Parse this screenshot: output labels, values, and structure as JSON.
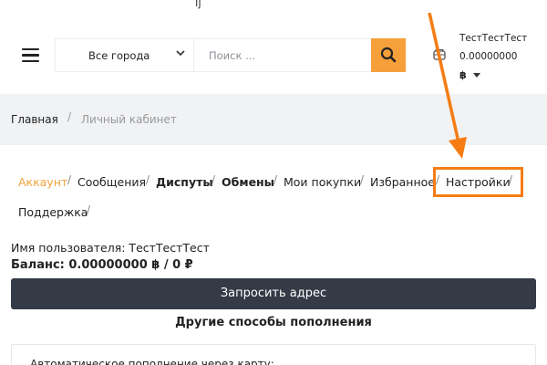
{
  "header": {
    "top_glyph": "ıʃ",
    "city_select": "Все города",
    "search_placeholder": "Поиск ...",
    "user": {
      "name": "ТестТестТест",
      "amount": "0.00000000",
      "currency": "฿"
    }
  },
  "breadcrumb": {
    "home": "Главная",
    "separator": "/",
    "current": "Личный кабинет"
  },
  "tabs": [
    {
      "label": "Аккаунт",
      "active": true
    },
    {
      "label": "Сообщения"
    },
    {
      "label": "Диспуты",
      "bold": true
    },
    {
      "label": "Обмены",
      "bold": true
    },
    {
      "label": "Мои покупки"
    },
    {
      "label": "Избранное"
    },
    {
      "label": "Настройки"
    },
    {
      "label": "Поддержка"
    }
  ],
  "content": {
    "username_line": "Имя пользователя: ТестТестТест",
    "balance_line": "Баланс: 0.00000000 ฿ / 0 ₽",
    "request_button": "Запросить адрес",
    "other_methods_title": "Другие способы пополнения",
    "card_text": "Автоматическое пополнение через карту:"
  },
  "colors": {
    "accent": "#f6a03b",
    "annotation": "#f57d14",
    "dark_button": "#343a46",
    "breadcrumb_bg": "#f1f2f4"
  }
}
